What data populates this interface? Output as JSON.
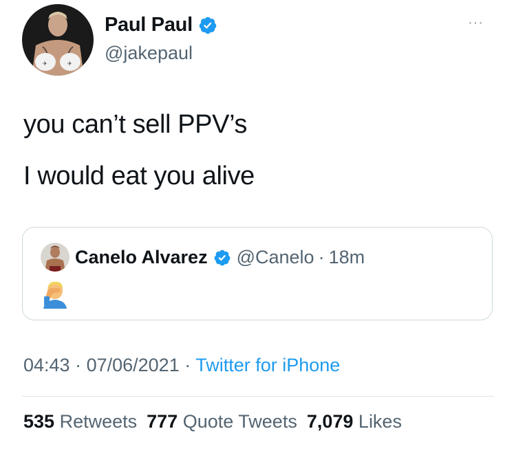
{
  "author": {
    "name": "Paul Paul",
    "handle": "@jakepaul"
  },
  "more_menu": "···",
  "tweet": {
    "lines": [
      "you can’t sell PPV’s",
      "I would eat you alive"
    ]
  },
  "quoted": {
    "name": "Canelo Alvarez",
    "handle": "@Canelo",
    "separator": "·",
    "time": "18m",
    "emoji": "facepalm-emoji"
  },
  "meta": {
    "time": "04:43",
    "sep1": " · ",
    "date": "07/06/2021",
    "sep2": " · ",
    "source": "Twitter for iPhone"
  },
  "stats": {
    "retweets_count": "535",
    "retweets_label": "Retweets",
    "quotes_count": "777",
    "quotes_label": "Quote Tweets",
    "likes_count": "7,079",
    "likes_label": "Likes"
  },
  "colors": {
    "accent": "#1d9bf0",
    "muted": "#536471",
    "border": "#cfd9de"
  }
}
